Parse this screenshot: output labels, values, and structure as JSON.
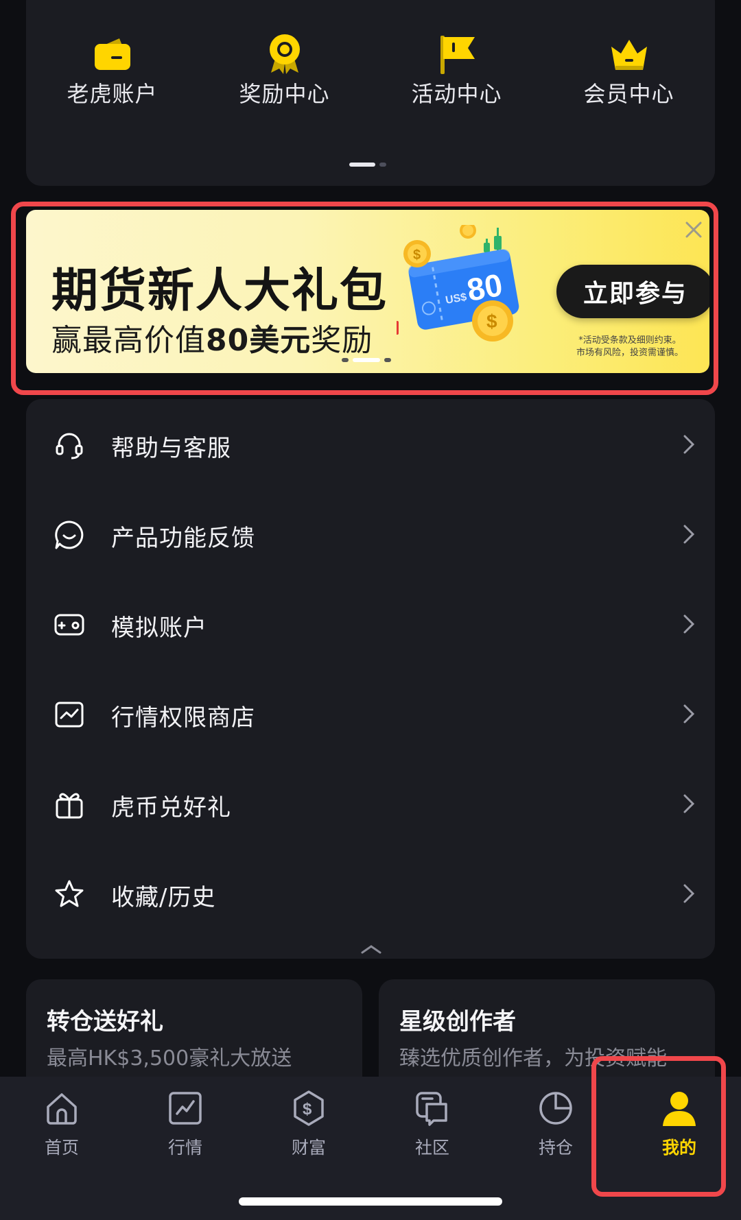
{
  "colors": {
    "accent_yellow": "#ffd500",
    "highlight_red": "#f0474b",
    "card_bg": "#1b1c22",
    "page_bg": "#0d0e12"
  },
  "quick_actions": [
    {
      "label": "老虎账户",
      "icon": "wallet-icon"
    },
    {
      "label": "奖励中心",
      "icon": "medal-icon"
    },
    {
      "label": "活动中心",
      "icon": "flag-icon"
    },
    {
      "label": "会员中心",
      "icon": "crown-icon"
    }
  ],
  "banner": {
    "title": "期货新人大礼包",
    "subtitle_prefix": "赢最高价值",
    "subtitle_amount": "80美元",
    "subtitle_suffix": "奖励",
    "cta": "立即参与",
    "disclaimer_line1": "*活动受条款及细则约束。",
    "disclaimer_line2": "市场有风险，投资需谨慎。",
    "ticket_currency": "US$",
    "ticket_amount": "80"
  },
  "menu": [
    {
      "label": "帮助与客服",
      "icon": "headset-icon"
    },
    {
      "label": "产品功能反馈",
      "icon": "feedback-smile-icon"
    },
    {
      "label": "模拟账户",
      "icon": "gamepad-icon"
    },
    {
      "label": "行情权限商店",
      "icon": "chart-store-icon"
    },
    {
      "label": "虎币兑好礼",
      "icon": "gift-icon"
    },
    {
      "label": "收藏/历史",
      "icon": "star-icon"
    }
  ],
  "promos": [
    {
      "title": "转仓送好礼",
      "subtitle": "最高HK$3,500豪礼大放送"
    },
    {
      "title": "星级创作者",
      "subtitle": "臻选优质创作者，为投资赋能"
    }
  ],
  "tabs": [
    {
      "label": "首页",
      "icon": "home-icon"
    },
    {
      "label": "行情",
      "icon": "market-chart-icon"
    },
    {
      "label": "财富",
      "icon": "dollar-shield-icon"
    },
    {
      "label": "社区",
      "icon": "community-icon"
    },
    {
      "label": "持仓",
      "icon": "pie-chart-icon"
    },
    {
      "label": "我的",
      "icon": "user-icon",
      "active": true
    }
  ]
}
